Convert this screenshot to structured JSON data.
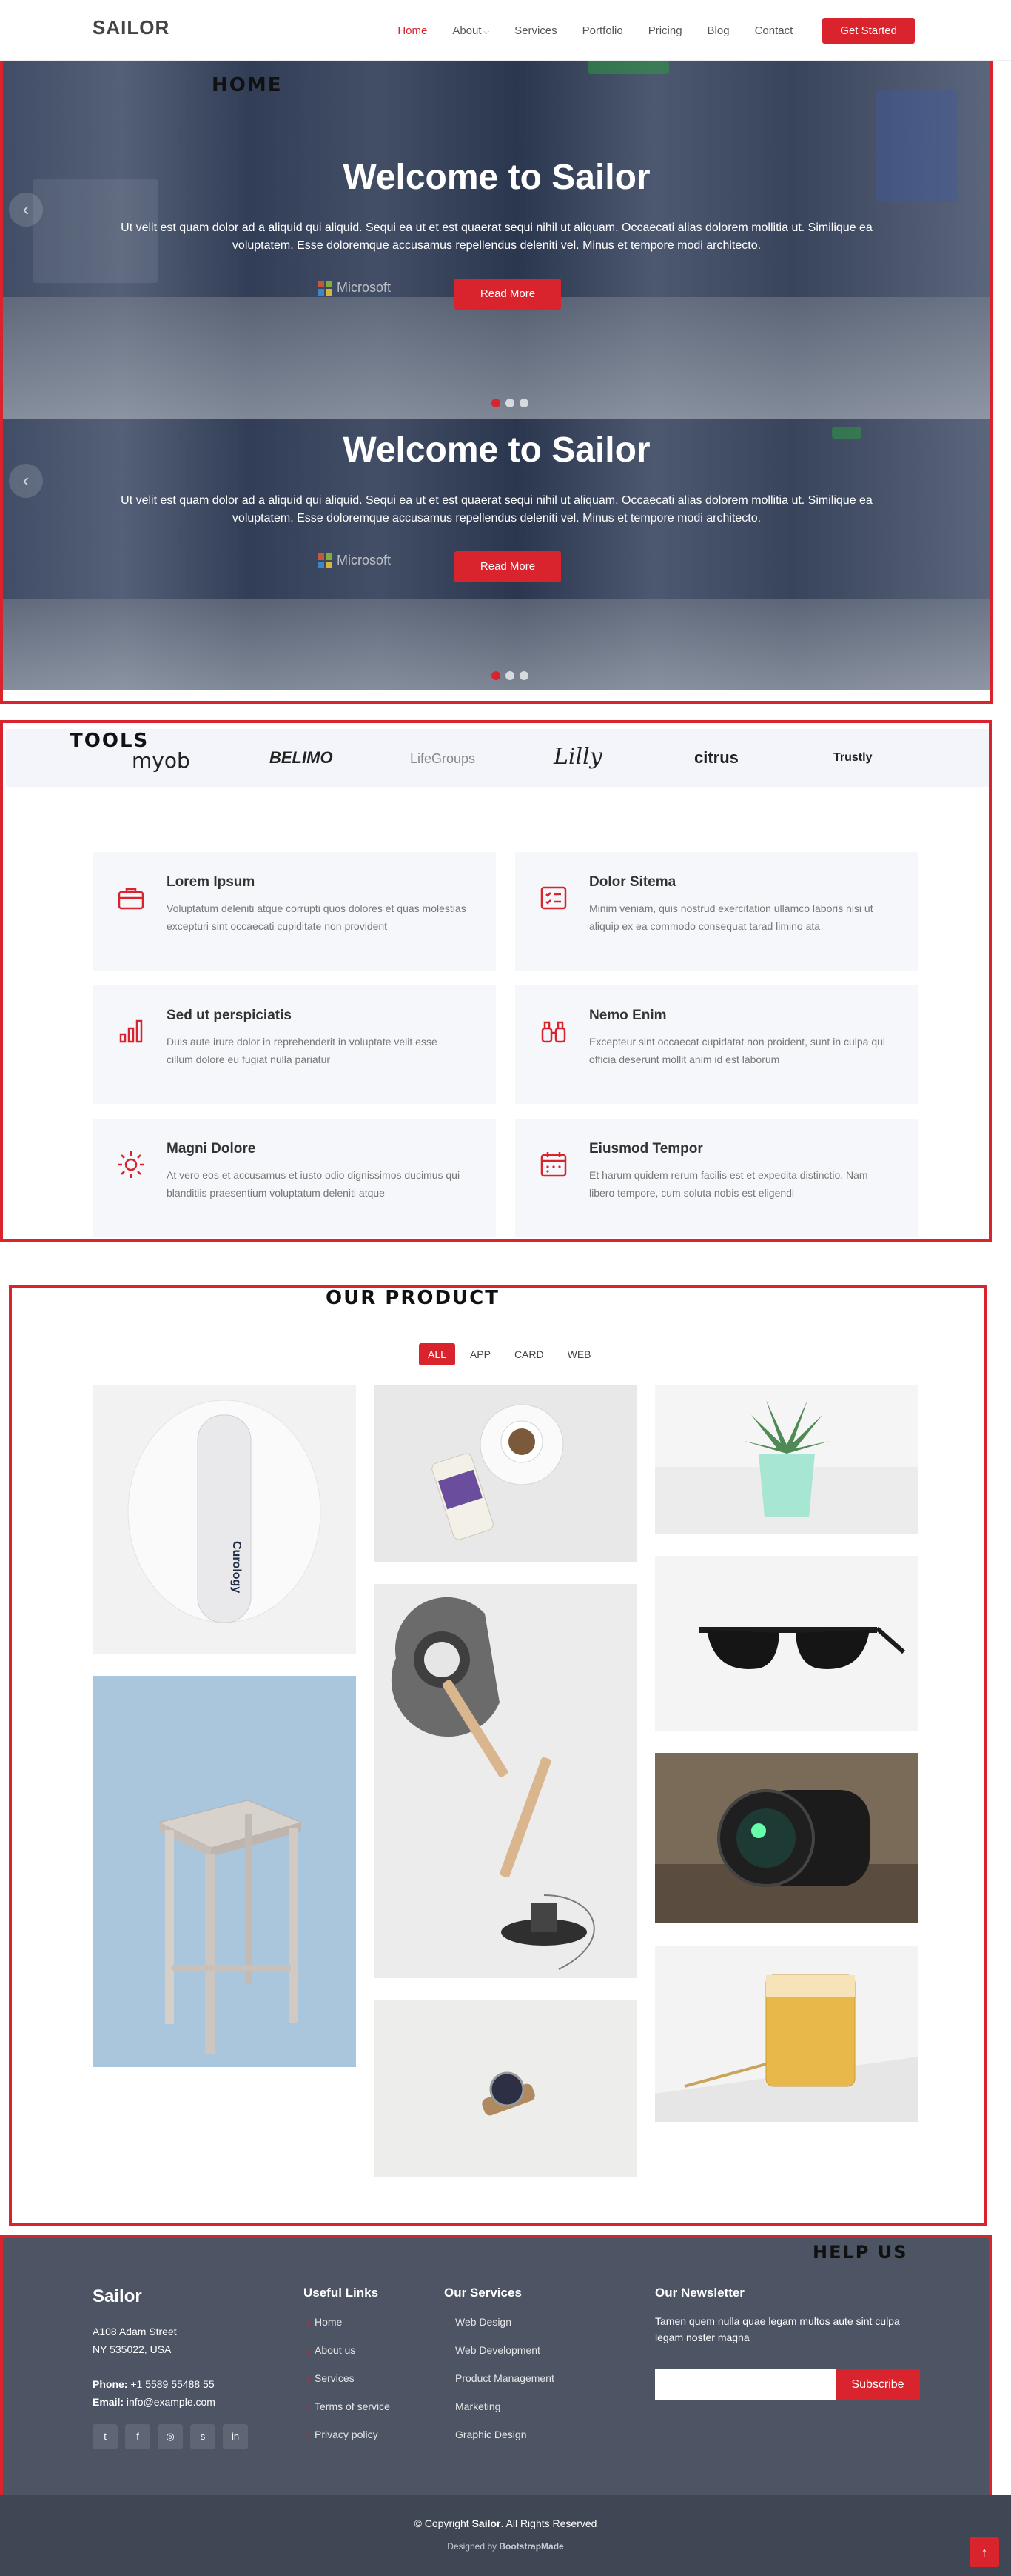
{
  "header": {
    "logo": "SAILOR",
    "nav": [
      {
        "label": "Home",
        "active": true
      },
      {
        "label": "About",
        "dropdown": true
      },
      {
        "label": "Services"
      },
      {
        "label": "Portfolio"
      },
      {
        "label": "Pricing"
      },
      {
        "label": "Blog"
      },
      {
        "label": "Contact"
      }
    ],
    "cta": "Get Started"
  },
  "hero": {
    "heading": "HOME",
    "slides": [
      {
        "title": "Welcome to Sailor",
        "text": "Ut velit est quam dolor ad a aliquid qui aliquid. Sequi ea ut et est quaerat sequi nihil ut aliquam. Occaecati alias dolorem mollitia ut. Similique ea voluptatem. Esse doloremque accusamus repellendus deleniti vel. Minus et tempore modi architecto.",
        "button": "Read More",
        "watermark": "Microsoft"
      },
      {
        "title": "Welcome to Sailor",
        "text": "Ut velit est quam dolor ad a aliquid qui aliquid. Sequi ea ut et est quaerat sequi nihil ut aliquam. Occaecati alias dolorem mollitia ut. Similique ea voluptatem. Esse doloremque accusamus repellendus deleniti vel. Minus et tempore modi architecto.",
        "button": "Read More",
        "watermark": "Microsoft"
      }
    ],
    "prev_icon": "chevron-left-icon"
  },
  "tools": {
    "heading": "TOOLS",
    "clients": [
      "myob",
      "BELIMO",
      "LifeGroups",
      "Lilly",
      "citrus",
      "Trustly"
    ]
  },
  "services": [
    {
      "icon": "briefcase-icon",
      "title": "Lorem Ipsum",
      "desc": "Voluptatum deleniti atque corrupti quos dolores et quas molestias excepturi sint occaecati cupiditate non provident"
    },
    {
      "icon": "checklist-icon",
      "title": "Dolor Sitema",
      "desc": "Minim veniam, quis nostrud exercitation ullamco laboris nisi ut aliquip ex ea commodo consequat tarad limino ata"
    },
    {
      "icon": "bar-chart-icon",
      "title": "Sed ut perspiciatis",
      "desc": "Duis aute irure dolor in reprehenderit in voluptate velit esse cillum dolore eu fugiat nulla pariatur"
    },
    {
      "icon": "binoculars-icon",
      "title": "Nemo Enim",
      "desc": "Excepteur sint occaecat cupidatat non proident, sunt in culpa qui officia deserunt mollit anim id est laborum"
    },
    {
      "icon": "brightness-icon",
      "title": "Magni Dolore",
      "desc": "At vero eos et accusamus et iusto odio dignissimos ducimus qui blanditiis praesentium voluptatum deleniti atque"
    },
    {
      "icon": "calendar-icon",
      "title": "Eiusmod Tempor",
      "desc": "Et harum quidem rerum facilis est et expedita distinctio. Nam libero tempore, cum soluta nobis est eligendi"
    }
  ],
  "products": {
    "heading": "OUR PRODUCT",
    "filters": [
      {
        "label": "ALL",
        "active": true
      },
      {
        "label": "APP"
      },
      {
        "label": "CARD"
      },
      {
        "label": "WEB"
      }
    ],
    "items": [
      {
        "name": "bottle-product-image",
        "brand": "Curology"
      },
      {
        "name": "cup-product-image"
      },
      {
        "name": "plant-product-image"
      },
      {
        "name": "stool-product-image"
      },
      {
        "name": "lamp-product-image"
      },
      {
        "name": "sunglasses-product-image"
      },
      {
        "name": "camera-lens-product-image"
      },
      {
        "name": "watch-product-image"
      },
      {
        "name": "glass-product-image"
      }
    ]
  },
  "footer": {
    "heading": "HELP US",
    "brand": "Sailor",
    "address_line1": "A108 Adam Street",
    "address_line2": "NY 535022, USA",
    "phone_label": "Phone:",
    "phone": "+1 5589 55488 55",
    "email_label": "Email:",
    "email": "info@example.com",
    "useful_links_title": "Useful Links",
    "useful_links": [
      "Home",
      "About us",
      "Services",
      "Terms of service",
      "Privacy policy"
    ],
    "services_title": "Our Services",
    "services_links": [
      "Web Design",
      "Web Development",
      "Product Management",
      "Marketing",
      "Graphic Design"
    ],
    "newsletter_title": "Our Newsletter",
    "newsletter_text": "Tamen quem nulla quae legam multos aute sint culpa legam noster magna",
    "subscribe": "Subscribe",
    "copyright_prefix": "© Copyright",
    "copyright_brand": "Sailor",
    "copyright_suffix": ". All Rights Reserved",
    "designed_prefix": "Designed by",
    "designed_by": "BootstrapMade",
    "social": [
      "twitter-icon",
      "facebook-icon",
      "instagram-icon",
      "skype-icon",
      "linkedin-icon"
    ],
    "social_glyphs": [
      "t",
      "f",
      "◎",
      "s",
      "in"
    ],
    "to_top_icon": "arrow-up-icon"
  },
  "colors": {
    "accent": "#d9232d",
    "footer_bg": "#4d5564",
    "footer_bottom": "#3f4654"
  }
}
